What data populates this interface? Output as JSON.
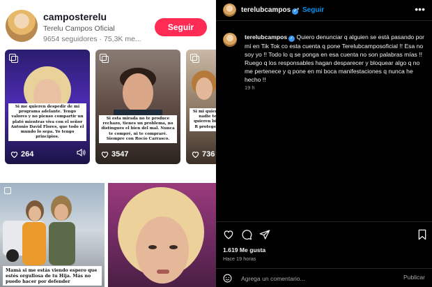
{
  "tiktok": {
    "username": "camposterelu",
    "display_name": "Terelu Campos Oficial",
    "stats": "9654 seguidores · 75,3K me...",
    "follow_label": "Seguir",
    "accent": "#fe2c55",
    "posts": [
      {
        "caption": "Si me quieren despedir de mi programa adelante. Tengo valores y no pienso compartir un plató mientras viva con el señor Antonio David Flores, que todo el mundo lo sepa. Yo tengo principios.",
        "likes": "264"
      },
      {
        "caption": "Si esta mirada no te produce rechazo, tienes un problema, no distingues el bien del mal. Nunca te compré, ni te compraré. Siempre con Rocío Carrasco.",
        "likes": "3547"
      },
      {
        "caption": "Si mi quieren nadie te quieren bien R protegeré",
        "likes": "736"
      }
    ],
    "bottom_posts": [
      {
        "caption": "Mamá si me estás viendo espero que estés orgullosa de tu Hija. Más no puedo hacer por defender"
      },
      {
        "caption": ""
      }
    ]
  },
  "instagram": {
    "header_user": "terelubcampos",
    "header_dot": "•",
    "header_follow": "Seguir",
    "comment_user": "terelubcampos",
    "comment_body": "Quiero denunciar q alguien se está pasando por mí en Tik Tok co esta cuenta q pone Terelubcamposoficial !! Esa no soy yo !! Todo lo q se ponga en esa cuenta no son palabras mías !! Ruego q los responsables hagan desparecer y bloquear algo q no me pertenece y q pone en mi boca manifestaciones q nunca he hecho !!",
    "comment_time": "19 h",
    "likes": "1.619 Me gusta",
    "post_time": "Hace 19 horas",
    "comment_placeholder": "Agrega un comentario...",
    "publish_label": "Publicar",
    "verified_color": "#3897f0",
    "link_color": "#0095f6"
  }
}
